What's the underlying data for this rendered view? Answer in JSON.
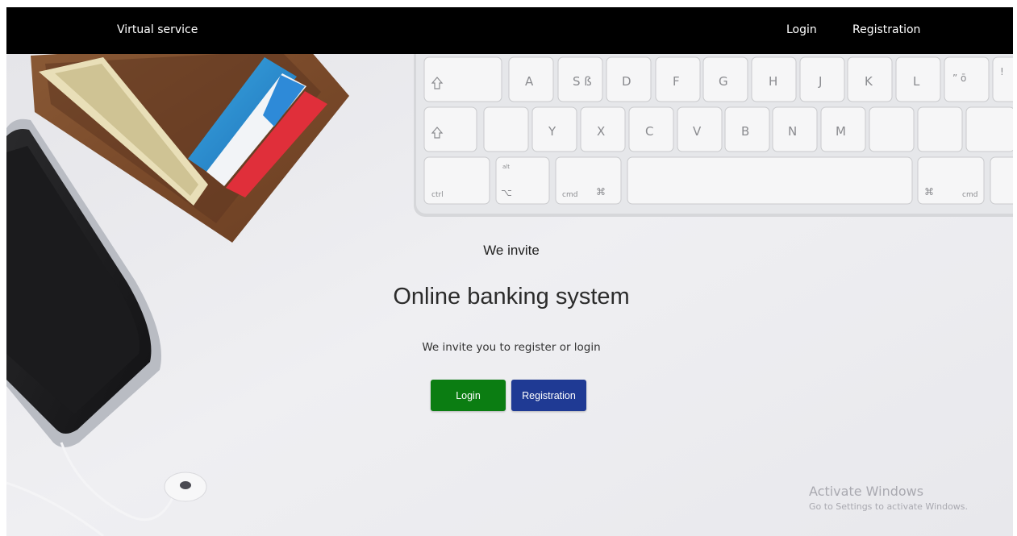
{
  "navbar": {
    "brand": "Virtual service",
    "links": {
      "login": "Login",
      "registration": "Registration"
    }
  },
  "hero": {
    "kicker": "We invite",
    "title": "Online banking system",
    "subtitle": "We invite you to register or login",
    "buttons": {
      "login": "Login",
      "registration": "Registration"
    }
  },
  "keyboard": {
    "row1": [
      "A",
      "S ß",
      "D",
      "F",
      "G",
      "H",
      "J",
      "K",
      "L"
    ],
    "row1_extra": [
      "” ō",
      "!"
    ],
    "row2": [
      "Y",
      "X",
      "C",
      "V",
      "B",
      "N",
      "M"
    ],
    "row3": {
      "ctrl": "ctrl",
      "alt": "alt",
      "opt": "⌥",
      "cmd_left": "cmd",
      "cmd_symbol": "⌘",
      "cmd_right": "cmd"
    }
  },
  "watermark": {
    "title": "Activate Windows",
    "subtitle": "Go to Settings to activate Windows."
  },
  "colors": {
    "navbar_bg": "#000000",
    "login_button": "#0b7d12",
    "registration_button": "#1f3a94",
    "page_bg": "#ececef"
  }
}
